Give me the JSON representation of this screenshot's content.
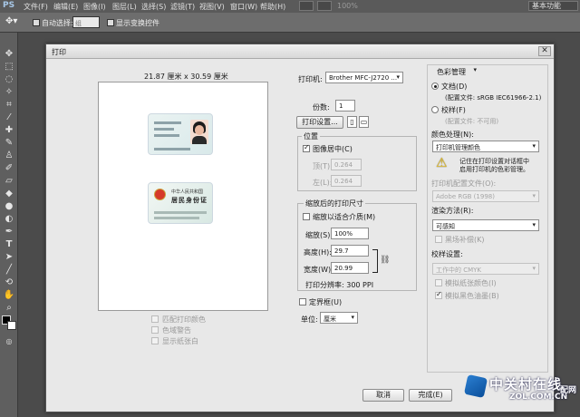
{
  "app": {
    "logo": "PS"
  },
  "menu": [
    "文件(F)",
    "编辑(E)",
    "图像(I)",
    "图层(L)",
    "选择(S)",
    "滤镜(T)",
    "视图(V)",
    "窗口(W)",
    "帮助(H)"
  ],
  "menu_right": {
    "zoom": "100%",
    "workspace": "基本功能"
  },
  "options_bar": {
    "auto_select_label": "自动选择:",
    "auto_select_value": "组",
    "show_transform_label": "显示变换控件"
  },
  "dialog": {
    "title": "打印",
    "close": "✕",
    "preview": {
      "paper_size": "21.87 厘米 x 30.59 厘米"
    },
    "left_checks": [
      {
        "label": "匹配打印颜色",
        "checked": false
      },
      {
        "label": "色域警告",
        "checked": false
      },
      {
        "label": "显示纸张白",
        "checked": false
      }
    ],
    "printer_label": "打印机:",
    "printer_value": "Brother MFC-J2720 ...",
    "copies_label": "份数:",
    "copies_value": "1",
    "print_settings_button": "打印设置...",
    "position": {
      "title": "位置",
      "center_label": "图像居中(C)",
      "center_checked": true,
      "top_label": "顶(T):",
      "top_value": "0.264",
      "left_label": "左(L):",
      "left_value": "0.264"
    },
    "scaled": {
      "title": "缩放后的打印尺寸",
      "fit_media_label": "缩放以适合介质(M)",
      "fit_media_checked": false,
      "scale_label": "缩放(S):",
      "scale_value": "100%",
      "height_label": "高度(H):",
      "height_value": "29.7",
      "width_label": "宽度(W):",
      "width_value": "20.99",
      "resolution_text": "打印分辨率: 300 PPI"
    },
    "bounding_box_label": "定界框(U)",
    "bounding_box_checked": false,
    "unit_label": "单位:",
    "unit_value": "厘米",
    "color_mgmt": {
      "header": "色彩管理",
      "document_label": "文档(D)",
      "document_profile": "(配置文件: sRGB IEC61966-2.1)",
      "proof_label": "校样(F)",
      "proof_profile": "(配置文件: 不可用)",
      "color_handling_label": "颜色处理(N):",
      "color_handling_value": "打印机管理颜色",
      "warning_text_1": "记住在打印设置对话框中",
      "warning_text_2": "启用打印机的色彩管理。",
      "printer_profile_label": "打印机配置文件(O):",
      "printer_profile_value": "Adobe RGB (1998)",
      "rendering_label": "渲染方法(R):",
      "rendering_value": "可感知",
      "black_point_label": "黑场补偿(K)",
      "proof_setup_label": "校样设置:",
      "proof_setup_value": "工作中的 CMYK",
      "simulate_paper_label": "模拟纸张颜色(I)",
      "simulate_black_label": "模拟黑色油墨(B)"
    },
    "cancel_button": "取消",
    "done_button": "完成(E)"
  },
  "id_card_back": {
    "line1": "中华人民共和国",
    "line2": "居民身份证"
  },
  "watermark": {
    "brand": "中关村在线",
    "sub": "ZOL.COM.CN",
    "corner": "配网"
  }
}
